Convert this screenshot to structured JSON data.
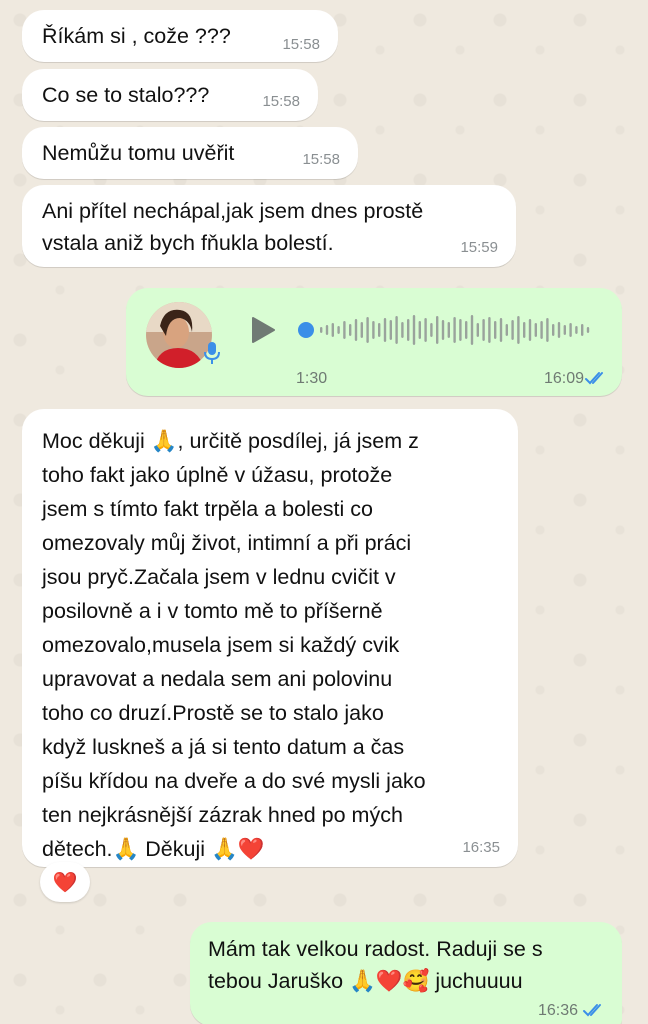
{
  "messages": {
    "m1": {
      "text": "Říkám si , cože ???",
      "time": "15:58"
    },
    "m2": {
      "text": "Co se to stalo???",
      "time": "15:58"
    },
    "m3": {
      "text": "Nemůžu tomu uvěřit",
      "time": "15:58"
    },
    "m4": {
      "line1": "Ani přítel nechápal,jak jsem dnes prostě",
      "line2": "vstala aniž bych fňukla bolestí.",
      "time": "15:59"
    },
    "voice": {
      "duration": "1:30",
      "time": "16:09",
      "status": "read"
    },
    "m5": {
      "lines": [
        "Moc děkuji 🙏, určitě posdílej, já jsem z",
        "toho fakt jako úplně v úžasu, protože",
        "jsem s tímto fakt trpěla a bolesti co",
        "omezovaly můj život, intimní a při práci",
        "jsou pryč.Začala jsem v lednu cvičit v",
        "posilovně a i v tomto mě to příšerně",
        "omezovalo,musela jsem si každý cvik",
        "upravovat a nedala sem ani polovinu",
        "toho co druzí.Prostě se to stalo jako",
        "když luskneš a já si tento datum a čas",
        "píšu křídou na dveře a do své mysli jako",
        "ten nejkrásnější zázrak hned po mých",
        "dětech.🙏 Děkuji 🙏❤️"
      ],
      "time": "16:35",
      "reaction": "❤️"
    },
    "m6": {
      "line1": "Mám tak velkou radost. Raduji se s",
      "line2": "tebou Jaruško 🙏❤️🥰 juchuuuu",
      "time": "16:36",
      "status": "read"
    }
  },
  "colors": {
    "incoming_bubble": "#ffffff",
    "outgoing_bubble": "#d9fdd3",
    "read_ticks": "#3b8fe8",
    "wallpaper": "#efe9df"
  }
}
